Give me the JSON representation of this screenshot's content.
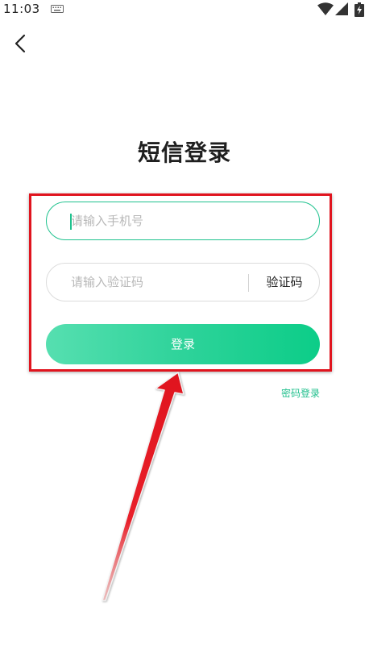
{
  "status_bar": {
    "time": "11:03",
    "icons": [
      "keyboard-icon",
      "wifi-icon",
      "signal-icon",
      "battery-charging-icon"
    ]
  },
  "nav": {
    "back_icon": "chevron-left-icon"
  },
  "page": {
    "title": "短信登录"
  },
  "form": {
    "phone_placeholder": "请输入手机号",
    "code_placeholder": "请输入验证码",
    "get_code_label": "验证码",
    "login_label": "登录",
    "password_login_label": "密码登录"
  },
  "colors": {
    "accent": "#1fc28e",
    "button_gradient_start": "#56dfb0",
    "button_gradient_end": "#0ccd88",
    "annotation_red": "#e0141e"
  }
}
